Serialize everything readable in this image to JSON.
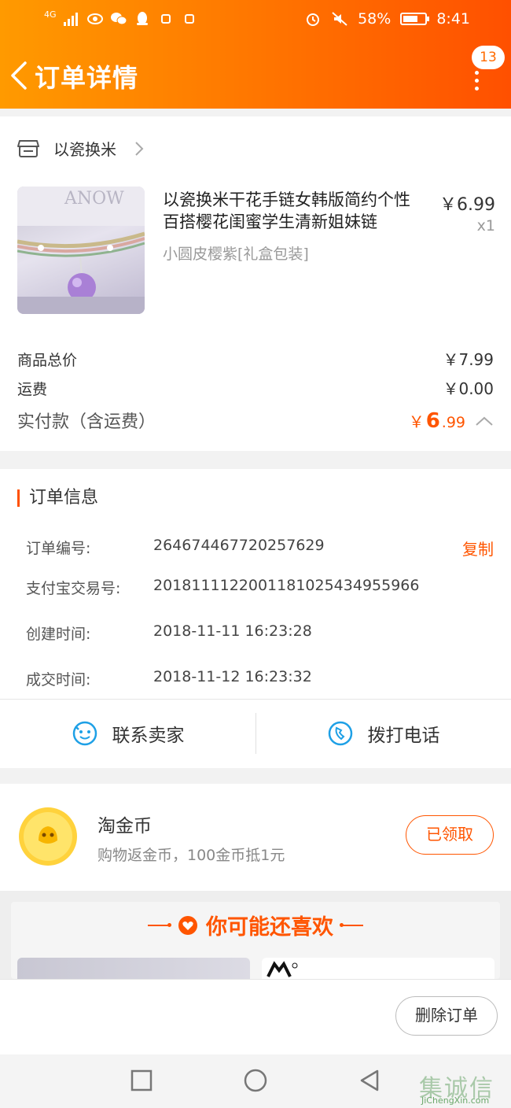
{
  "status_bar": {
    "signal": "4G",
    "battery_percent": "58%",
    "time": "8:41",
    "icons": [
      "signal-icon",
      "eye-icon",
      "wechat-icon",
      "qq-icon",
      "notification-icon",
      "alarm-icon",
      "mute-icon",
      "battery-icon"
    ]
  },
  "header": {
    "title": "订单详情",
    "message_count": "13",
    "accent": "#ff5000"
  },
  "shop": {
    "name": "以瓷换米"
  },
  "product": {
    "title": "以瓷换米干花手链女韩版简约个性百搭樱花闺蜜学生清新姐妹链",
    "sku": "小圆皮樱紫[礼盒包装]",
    "price": "￥6.99",
    "qty": "x1"
  },
  "summary": {
    "total_label": "商品总价",
    "total_value": "￥7.99",
    "shipping_label": "运费",
    "shipping_value": "￥0.00",
    "paid_label": "实付款（含运费）",
    "paid_currency": "￥",
    "paid_int": "6",
    "paid_dec": ".99"
  },
  "order_info": {
    "title": "订单信息",
    "rows": [
      {
        "label": "订单编号:",
        "value": "264674467720257629"
      },
      {
        "label": "支付宝交易号:",
        "value": "2018111122001181025434955966"
      },
      {
        "label": "创建时间:",
        "value": "2018-11-11 16:23:28"
      },
      {
        "label": "成交时间:",
        "value": "2018-11-12 16:23:32"
      }
    ],
    "copy_label": "复制",
    "contact_seller": "联系卖家",
    "call_phone": "拨打电话"
  },
  "coin": {
    "title": "淘金币",
    "desc": "购物返金币，100金币抵1元",
    "button": "已领取"
  },
  "recommend": {
    "title": "你可能还喜欢"
  },
  "actions": {
    "delete_order": "删除订单"
  },
  "watermark": {
    "text": "集诚信",
    "sub": "JiChengXin.com"
  }
}
